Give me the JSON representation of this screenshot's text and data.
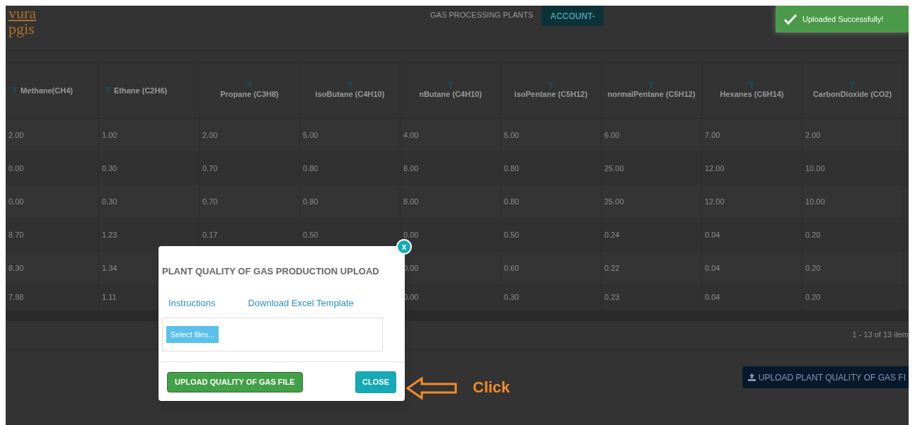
{
  "header": {
    "logo_lines": [
      "vura",
      "pgis"
    ],
    "title": "GAS PROCESSING PLANTS",
    "account_button": "ACCOUNT-"
  },
  "toast": {
    "message": "Uploaded Successfully!"
  },
  "table": {
    "columns": [
      {
        "label": "Methane(CH4)",
        "kind": "inline"
      },
      {
        "label": "Ethane (C2H6)",
        "kind": "inline"
      },
      {
        "label": "Propane (C3H8)",
        "kind": "stacked"
      },
      {
        "label": "isoButane (C4H10)",
        "kind": "stacked"
      },
      {
        "label": "nButane (C4H10)",
        "kind": "stacked"
      },
      {
        "label": "isoPentane (C5H12)",
        "kind": "stacked"
      },
      {
        "label": "normalPentane (C5H12)",
        "kind": "stacked"
      },
      {
        "label": "Hexanes (C6H14)",
        "kind": "stacked"
      },
      {
        "label": "CarbonDioxide (CO2)",
        "kind": "stacked"
      }
    ],
    "rows": [
      [
        "2.00",
        "1.00",
        "2.00",
        "5.00",
        "4.00",
        "5.00",
        "6.00",
        "7.00",
        "2.00"
      ],
      [
        "0.00",
        "0.30",
        "0.70",
        "0.80",
        "8.00",
        "0.80",
        "25.00",
        "12.00",
        "10.00"
      ],
      [
        "0.00",
        "0.30",
        "0.70",
        "0.80",
        "8.00",
        "0.80",
        "25.00",
        "12.00",
        "10.00"
      ],
      [
        "8.70",
        "1.23",
        "0.17",
        "0.50",
        "0.00",
        "0.50",
        "0.24",
        "0.04",
        "0.20"
      ],
      [
        "8.30",
        "1.34",
        null,
        null,
        "0.00",
        "0.60",
        "0.22",
        "0.04",
        "0.20"
      ],
      [
        "7.98",
        "1.11",
        null,
        null,
        "0.00",
        "0.30",
        "0.23",
        "0.04",
        "0.20"
      ]
    ],
    "pager": "1 - 13 of 13 item"
  },
  "upload_plant_button": "UPLOAD PLANT QUALITY OF GAS FI",
  "modal": {
    "title": "PLANT QUALITY OF GAS PRODUCTION UPLOAD",
    "links": [
      "Instructions",
      "Download Excel Template"
    ],
    "select_files": "Select files...",
    "upload_button": "UPLOAD QUALITY OF GAS FILE",
    "close_button": "CLOSE",
    "close_icon": "x"
  },
  "annotation": {
    "text": "Click"
  }
}
